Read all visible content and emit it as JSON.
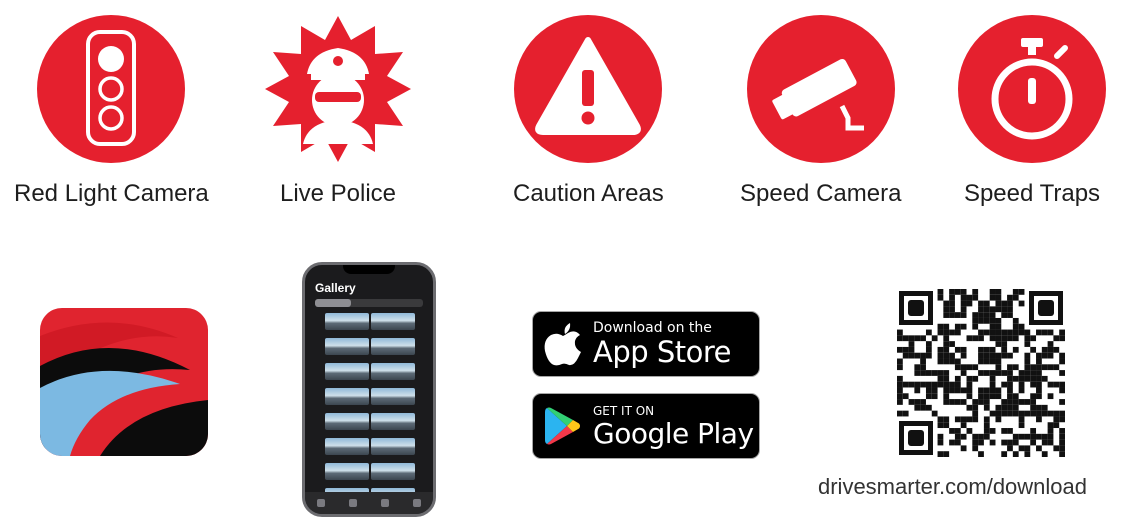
{
  "alerts": [
    {
      "label": "Red Light Camera",
      "icon": "traffic-light-icon"
    },
    {
      "label": "Live Police",
      "icon": "police-officer-icon"
    },
    {
      "label": "Caution Areas",
      "icon": "warning-triangle-icon"
    },
    {
      "label": "Speed Camera",
      "icon": "security-camera-icon"
    },
    {
      "label": "Speed Traps",
      "icon": "stopwatch-icon"
    }
  ],
  "colors": {
    "alert_red": "#e5202e",
    "badge_black": "#000000"
  },
  "app": {
    "icon": "drivesmarter-app-icon"
  },
  "phone": {
    "screen_title": "Gallery"
  },
  "stores": {
    "app_store": {
      "small": "Download on the",
      "big": "App Store"
    },
    "google_play": {
      "small": "GET IT ON",
      "big": "Google Play"
    }
  },
  "qr": {
    "caption": "drivesmarter.com/download",
    "icon": "qr-code-icon"
  }
}
